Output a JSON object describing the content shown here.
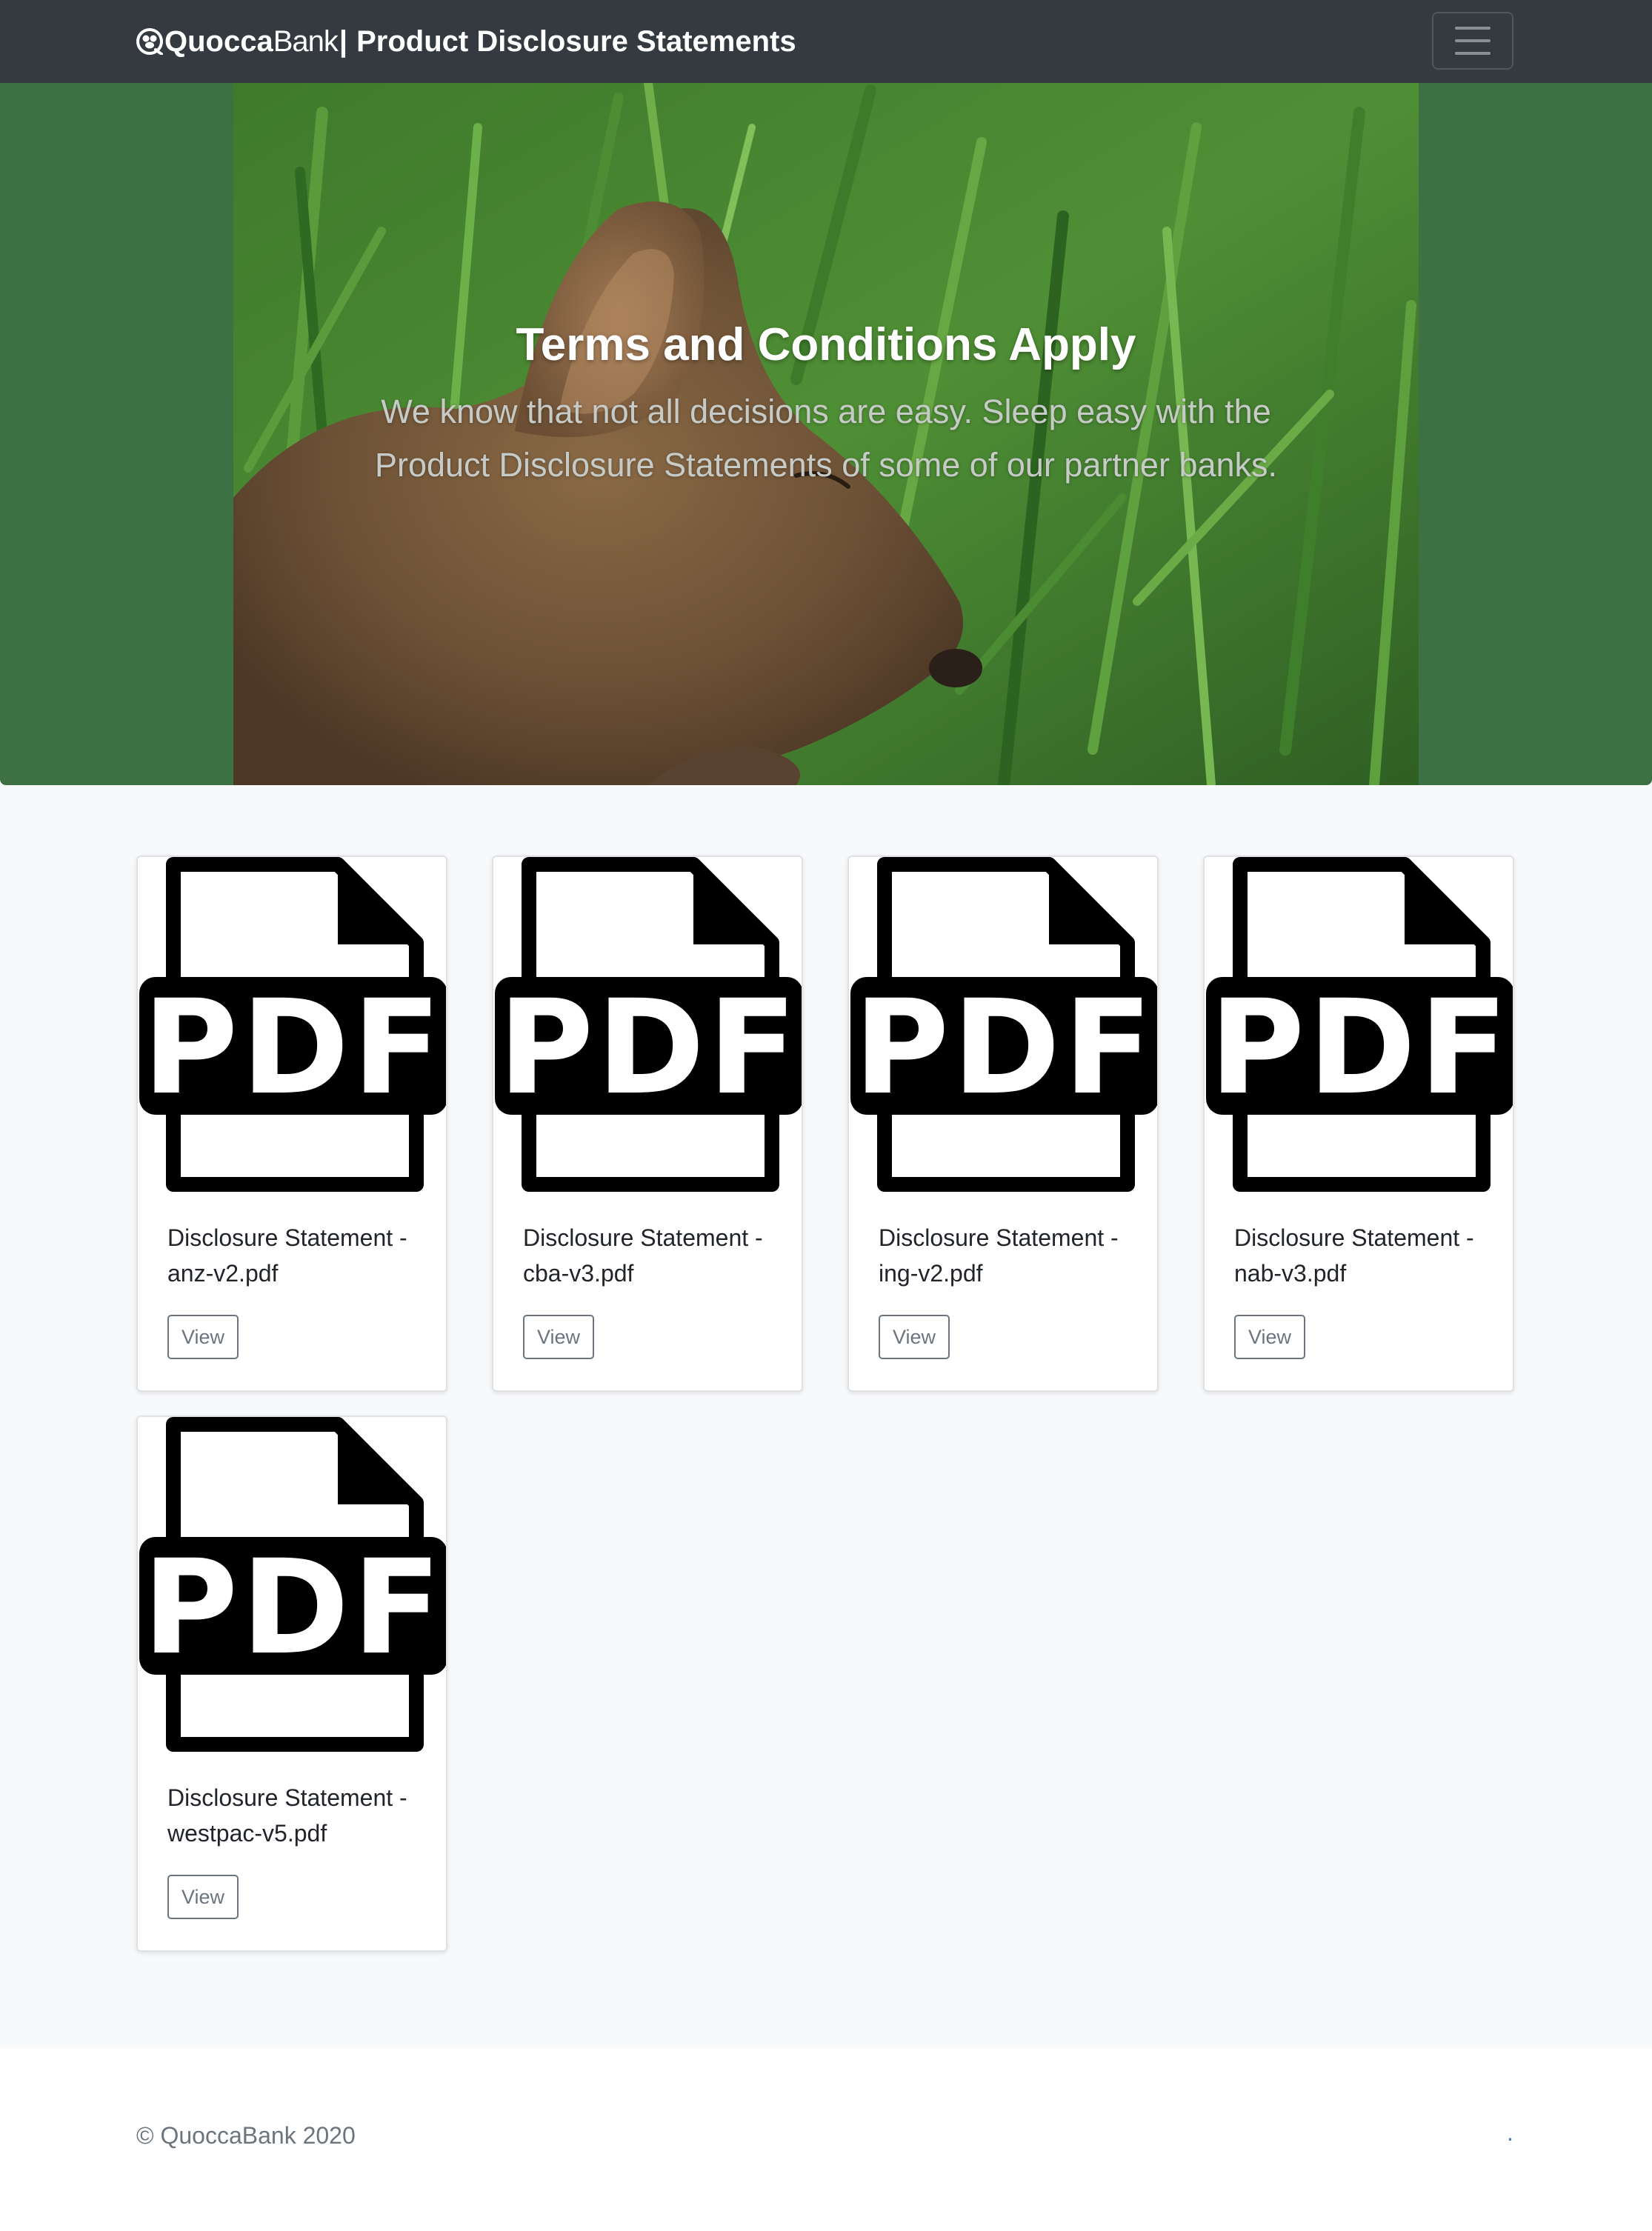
{
  "navbar": {
    "brand_quocca": "Quocca",
    "brand_bank": "Bank",
    "brand_separator": "|",
    "title": "Product Disclosure Statements",
    "logo_icon": "quokka-logo-icon",
    "toggler_icon": "hamburger-menu-icon"
  },
  "hero": {
    "title": "Terms and Conditions Apply",
    "lead": "We know that not all decisions are easy. Sleep easy with the Product Disclosure Statements of some of our partner banks.",
    "image": "quokka sleeping in grass"
  },
  "documents": [
    {
      "label": "Disclosure Statement - anz-v2.pdf",
      "button": "View",
      "icon": "pdf-file-icon"
    },
    {
      "label": "Disclosure Statement - cba-v3.pdf",
      "button": "View",
      "icon": "pdf-file-icon"
    },
    {
      "label": "Disclosure Statement - ing-v2.pdf",
      "button": "View",
      "icon": "pdf-file-icon"
    },
    {
      "label": "Disclosure Statement - nab-v3.pdf",
      "button": "View",
      "icon": "pdf-file-icon"
    },
    {
      "label": "Disclosure Statement - westpac-v5.pdf",
      "button": "View",
      "icon": "pdf-file-icon"
    }
  ],
  "footer": {
    "copyright": "© QuoccaBank 2020",
    "link": "."
  },
  "colors": {
    "navbar_bg": "#343a40",
    "hero_bg": "#3d7042",
    "page_bg": "#f8f9fa",
    "button_outline": "#6c757d",
    "link": "#4a80b5"
  }
}
